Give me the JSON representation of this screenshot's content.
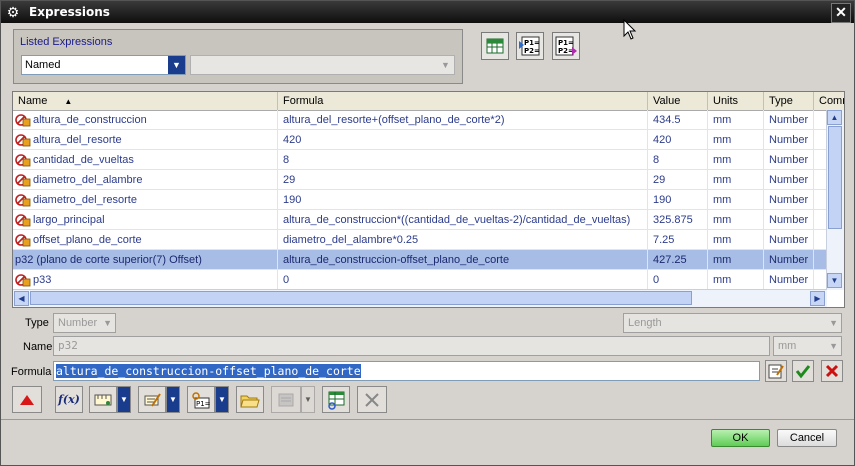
{
  "window": {
    "title": "Expressions"
  },
  "listed": {
    "label": "Listed Expressions",
    "selected": "Named",
    "secondary": ""
  },
  "toolbar_top": [
    {
      "icon": "spreadsheet-icon"
    },
    {
      "icon": "p1-p2-import-icon",
      "text": "P1=\nP2="
    },
    {
      "icon": "p1-p2-export-icon",
      "text": "P1=\nP2="
    }
  ],
  "table": {
    "columns": [
      "Name",
      "Formula",
      "Value",
      "Units",
      "Type",
      "Comme"
    ],
    "rows": [
      {
        "name": "altura_de_construccion",
        "formula": "altura_del_resorte+(offset_plano_de_corte*2)",
        "value": "434.5",
        "units": "mm",
        "type": "Number",
        "icon": true,
        "selected": false
      },
      {
        "name": "altura_del_resorte",
        "formula": "420",
        "value": "420",
        "units": "mm",
        "type": "Number",
        "icon": true,
        "selected": false
      },
      {
        "name": "cantidad_de_vueltas",
        "formula": "8",
        "value": "8",
        "units": "mm",
        "type": "Number",
        "icon": true,
        "selected": false
      },
      {
        "name": "diametro_del_alambre",
        "formula": "29",
        "value": "29",
        "units": "mm",
        "type": "Number",
        "icon": true,
        "selected": false
      },
      {
        "name": "diametro_del_resorte",
        "formula": "190",
        "value": "190",
        "units": "mm",
        "type": "Number",
        "icon": true,
        "selected": false
      },
      {
        "name": "largo_principal",
        "formula": "altura_de_construccion*((cantidad_de_vueltas-2)/cantidad_de_vueltas)",
        "value": "325.875",
        "units": "mm",
        "type": "Number",
        "icon": true,
        "selected": false
      },
      {
        "name": "offset_plano_de_corte",
        "formula": "diametro_del_alambre*0.25",
        "value": "7.25",
        "units": "mm",
        "type": "Number",
        "icon": true,
        "selected": false
      },
      {
        "name": "p32  (plano de corte superior(7) Offset)",
        "formula": "altura_de_construccion-offset_plano_de_corte",
        "value": "427.25",
        "units": "mm",
        "type": "Number",
        "icon": false,
        "selected": true
      },
      {
        "name": "p33",
        "formula": "0",
        "value": "0",
        "units": "mm",
        "type": "Number",
        "icon": true,
        "selected": false
      }
    ]
  },
  "editor": {
    "type_label": "Type",
    "type_value": "Number",
    "dimension_value": "Length",
    "name_label": "Name",
    "name_value": "p32",
    "units_value": "mm",
    "formula_label": "Formula",
    "formula_value": "altura_de_construccion-offset_plano_de_corte"
  },
  "buttons": {
    "ok": "OK",
    "cancel": "Cancel",
    "fx": "f(x)"
  },
  "colors": {
    "accent": "#1a3c8c",
    "selection": "#a7bde6",
    "ok": "#5fcc55"
  }
}
